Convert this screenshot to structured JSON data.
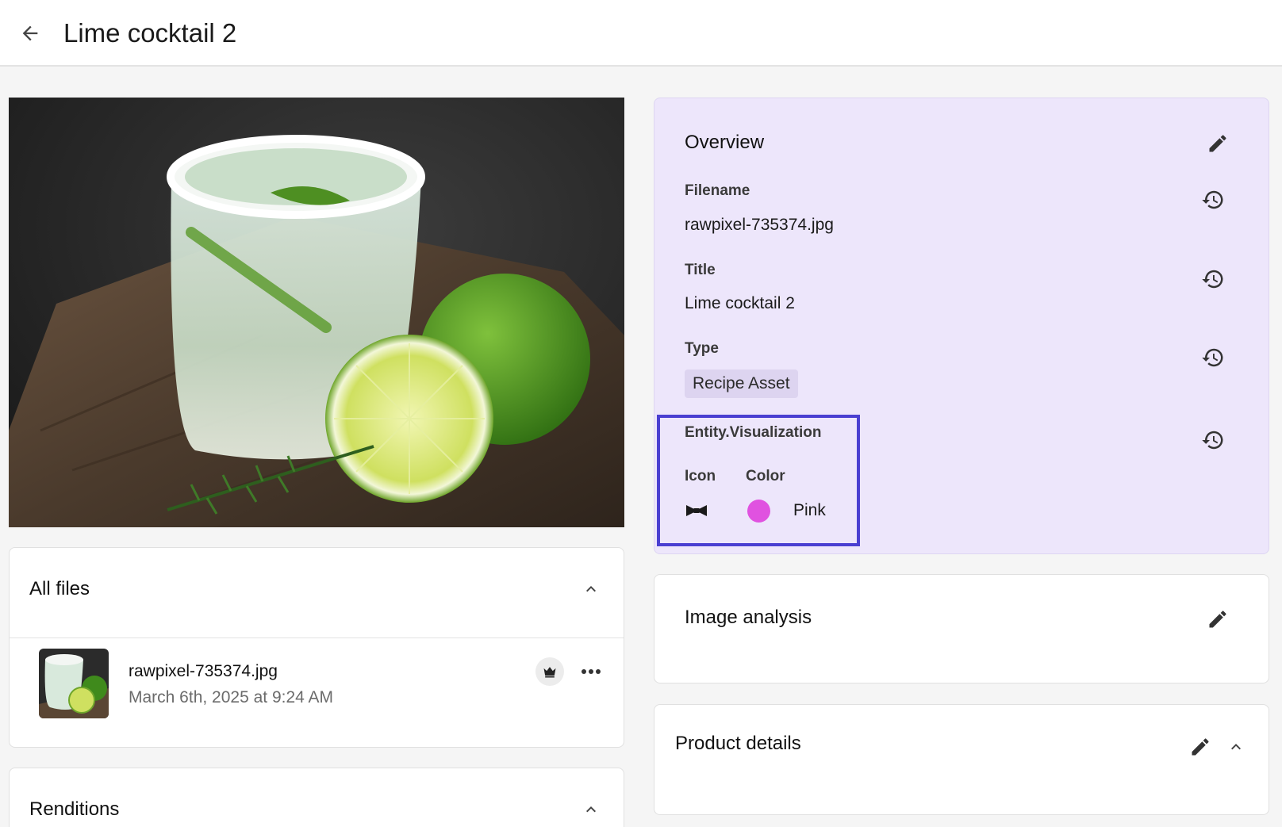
{
  "header": {
    "title": "Lime cocktail 2"
  },
  "all_files": {
    "title": "All files",
    "files": [
      {
        "name": "rawpixel-735374.jpg",
        "date": "March 6th, 2025 at 9:24 AM"
      }
    ]
  },
  "renditions": {
    "title": "Renditions"
  },
  "overview": {
    "title": "Overview",
    "filename_label": "Filename",
    "filename_value": "rawpixel-735374.jpg",
    "title_label": "Title",
    "title_value": "Lime cocktail 2",
    "type_label": "Type",
    "type_value": "Recipe Asset",
    "viz_label": "Entity.Visualization",
    "icon_label": "Icon",
    "icon_name": "bow-tie-icon",
    "color_label": "Color",
    "color_value": "Pink",
    "color_hex": "#e052e0"
  },
  "image_analysis": {
    "title": "Image analysis"
  },
  "product_details": {
    "title": "Product details"
  },
  "colors": {
    "overview_bg": "#ede6fb",
    "highlight_border": "#4a3fd1",
    "chip_bg": "#ddd4f0"
  }
}
